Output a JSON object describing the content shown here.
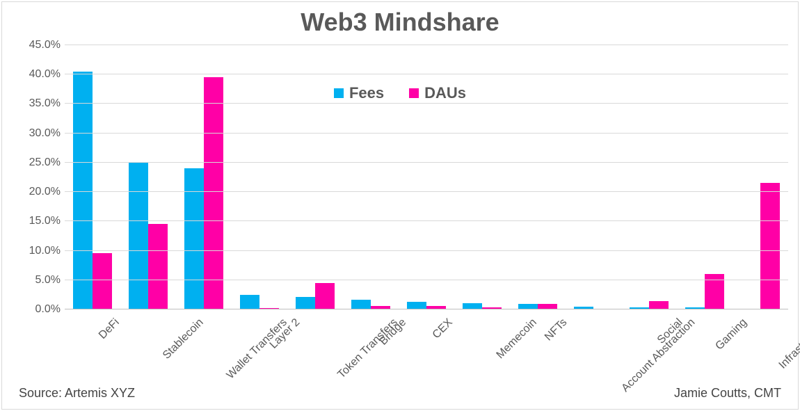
{
  "chart_data": {
    "type": "bar",
    "title": "Web3 Mindshare",
    "xlabel": "",
    "ylabel": "",
    "ylim": [
      0,
      45
    ],
    "ytick_step": 5,
    "ytick_format": "percent1",
    "legend_position": "top",
    "categories": [
      "DeFi",
      "Stablecoin",
      "Wallet Transfers",
      "Layer 2",
      "Token Transfers",
      "Bridge",
      "CEX",
      "Memecoin",
      "NFTs",
      "Account Abstraction",
      "Social",
      "Gaming",
      "Infrastructure"
    ],
    "series": [
      {
        "name": "Fees",
        "color": "#00B0F0",
        "values": [
          40.5,
          25.0,
          24.0,
          2.5,
          2.1,
          1.7,
          1.3,
          1.1,
          0.9,
          0.5,
          0.4,
          0.3,
          0.0
        ]
      },
      {
        "name": "DAUs",
        "color": "#FF00A6",
        "values": [
          9.6,
          14.6,
          39.6,
          0.2,
          4.5,
          0.6,
          0.6,
          0.3,
          0.9,
          0.0,
          1.4,
          6.0,
          21.5
        ]
      }
    ],
    "source": "Source: Artemis XYZ",
    "attribution": "Jamie Coutts, CMT"
  }
}
